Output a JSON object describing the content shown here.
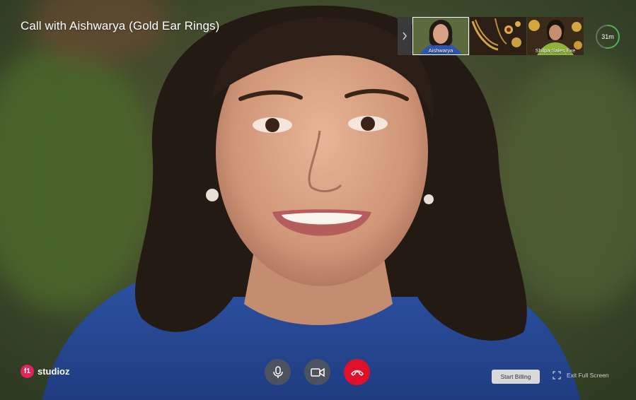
{
  "call": {
    "title": "Call with Aishwarya (Gold Ear Rings)"
  },
  "participants": [
    {
      "label": "Aishwarya",
      "active": true
    },
    {
      "label": ""
    },
    {
      "label": "Shilpa Sales Exe"
    }
  ],
  "timer": {
    "label": "31m",
    "progress": 0.52
  },
  "brand": {
    "badge": "f1",
    "name": "studioz",
    "color": "#e0245e"
  },
  "controls": {
    "mic_icon": "microphone-icon",
    "camera_icon": "video-camera-icon",
    "end_icon": "phone-hangup-icon",
    "end_color": "#e0102a"
  },
  "actions": {
    "start_billing": "Start Billing",
    "exit_fullscreen": "Exit Full Screen"
  }
}
